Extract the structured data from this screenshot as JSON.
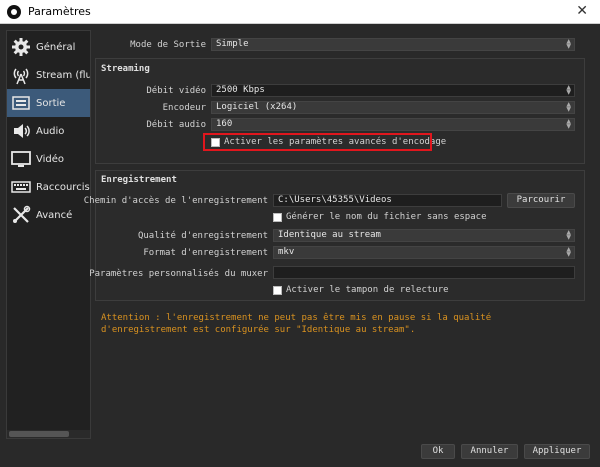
{
  "window": {
    "title": "Paramètres"
  },
  "sidebar": {
    "items": [
      {
        "label": "Général",
        "icon": "gear-icon"
      },
      {
        "label": "Stream (flux)",
        "icon": "broadcast-icon"
      },
      {
        "label": "Sortie",
        "icon": "output-icon"
      },
      {
        "label": "Audio",
        "icon": "speaker-icon"
      },
      {
        "label": "Vidéo",
        "icon": "monitor-icon"
      },
      {
        "label": "Raccourcis cl",
        "icon": "keyboard-icon"
      },
      {
        "label": "Avancé",
        "icon": "tools-icon"
      }
    ],
    "active_index": 2
  },
  "output_mode": {
    "label": "Mode de Sortie",
    "value": "Simple"
  },
  "streaming": {
    "title": "Streaming",
    "video_bitrate": {
      "label": "Débit vidéo",
      "value": "2500 Kbps"
    },
    "encoder": {
      "label": "Encodeur",
      "value": "Logiciel (x264)"
    },
    "audio_bitrate": {
      "label": "Débit audio",
      "value": "160"
    },
    "advanced_checkbox": "Activer les paramètres avancés d'encodage"
  },
  "recording": {
    "title": "Enregistrement",
    "path": {
      "label": "Chemin d'accès de l'enregistrement",
      "value": "C:\\Users\\45355\\Videos"
    },
    "browse_button": "Parcourir",
    "no_space_checkbox": "Générer le nom du fichier sans espace",
    "quality": {
      "label": "Qualité d'enregistrement",
      "value": "Identique au stream"
    },
    "format": {
      "label": "Format d'enregistrement",
      "value": "mkv"
    },
    "muxer": {
      "label": "Paramètres personnalisés du muxer",
      "value": ""
    },
    "replay_buffer_checkbox": "Activer le tampon de relecture"
  },
  "warning": {
    "line1": "Attention : l'enregistrement ne peut pas être mis en pause si la qualité",
    "line2": "d'enregistrement est configurée sur \"Identique au stream\"."
  },
  "buttons": {
    "ok": "Ok",
    "cancel": "Annuler",
    "apply": "Appliquer"
  },
  "colors": {
    "accent": "#3c5a7a",
    "warning": "#d99220",
    "highlight": "#e1161d"
  }
}
